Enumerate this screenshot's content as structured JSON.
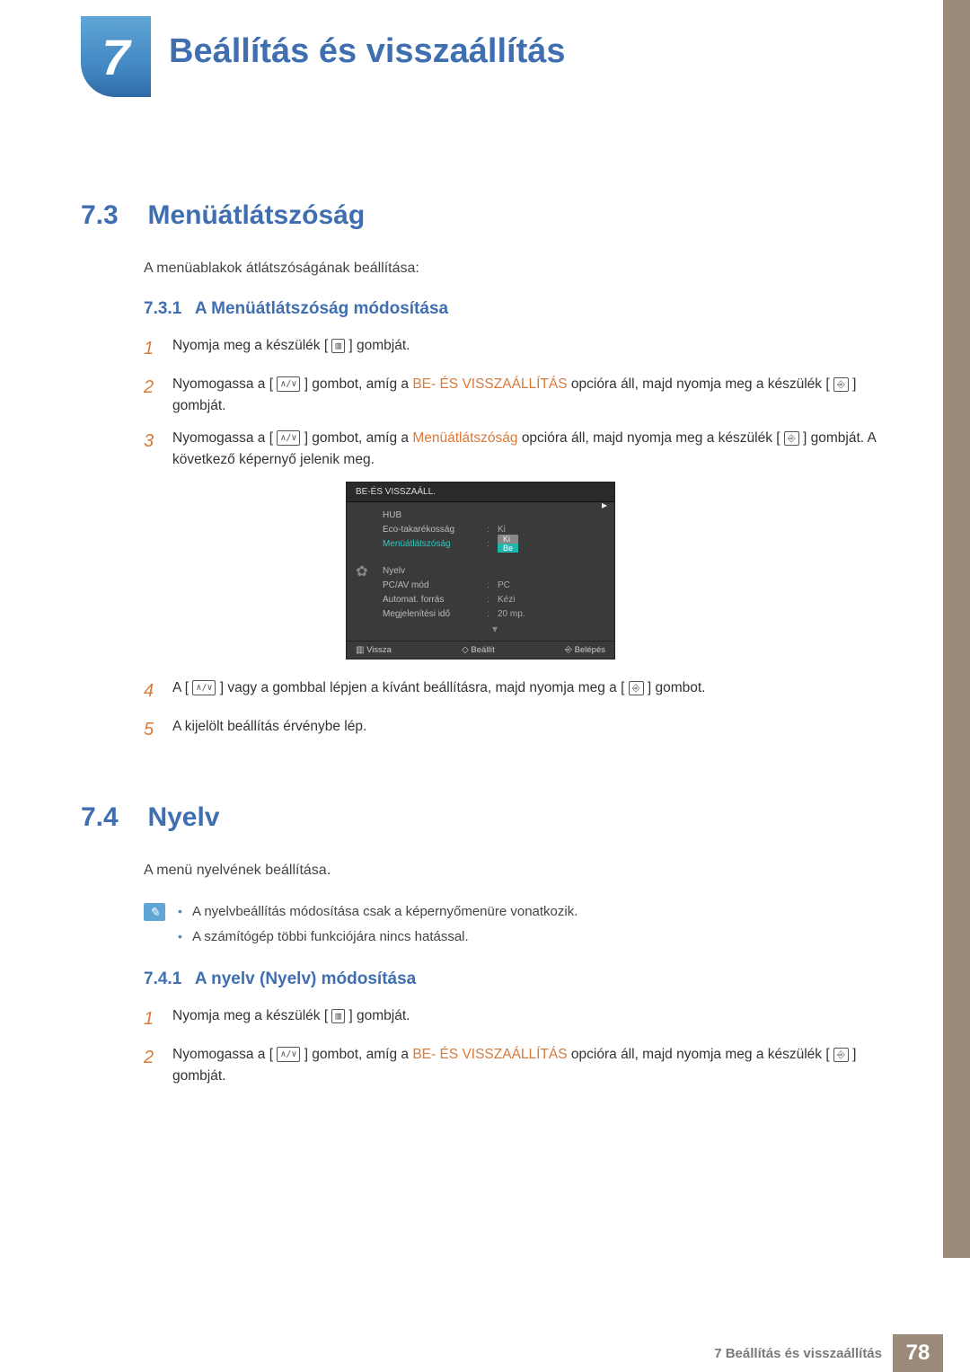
{
  "header": {
    "chapter_num": "7",
    "chapter_title": "Beállítás és visszaállítás"
  },
  "sections": [
    {
      "num": "7.3",
      "title": "Menüátlátszóság",
      "intro": "A menüablakok átlátszóságának beállítása:",
      "subsections": [
        {
          "num": "7.3.1",
          "title": "A Menüátlátszóság módosítása",
          "steps": [
            {
              "n": "1",
              "pre": "Nyomja meg a készülék [",
              "post": " ] gombját."
            },
            {
              "n": "2",
              "a": "Nyomogassa a [",
              "b": "] gombot, amíg a ",
              "hl": "BE- ÉS VISSZAÁLLÍTÁS",
              "c": " opcióra áll, majd nyomja meg a készülék [",
              "d": "] gombját."
            },
            {
              "n": "3",
              "a": "Nyomogassa a [",
              "b": "] gombot, amíg a ",
              "hl": "Menüátlátszóság",
              "c": " opcióra áll, majd nyomja meg a készülék [",
              "d": "] gombját. A következő képernyő jelenik meg."
            },
            {
              "n": "4",
              "a": "A [",
              "b": "] vagy a gombbal lépjen a kívánt beállításra, majd nyomja meg a [",
              "c": "] gombot."
            },
            {
              "n": "5",
              "text": "A kijelölt beállítás érvénybe lép."
            }
          ]
        }
      ]
    },
    {
      "num": "7.4",
      "title": "Nyelv",
      "intro": "A menü nyelvének beállítása.",
      "notes": [
        "A nyelvbeállítás módosítása csak a képernyőmenüre vonatkozik.",
        "A számítógép többi funkciójára nincs hatással."
      ],
      "subsections": [
        {
          "num": "7.4.1",
          "title": "A nyelv (Nyelv) módosítása",
          "steps": [
            {
              "n": "1",
              "pre": "Nyomja meg a készülék [",
              "post": " ] gombját."
            },
            {
              "n": "2",
              "a": "Nyomogassa a [",
              "b": "] gombot, amíg a ",
              "hl": "BE- ÉS VISSZAÁLLÍTÁS",
              "c": " opcióra áll, majd nyomja meg a készülék [",
              "d": "] gombját."
            }
          ]
        }
      ]
    }
  ],
  "osd": {
    "title": "BE-ÉS VISSZAÁLL.",
    "items": [
      {
        "label": "HUB"
      },
      {
        "label": "Eco-takarékosság",
        "value": "Ki"
      },
      {
        "label": "Menüátlátszóság",
        "options": [
          "Ki",
          "Be"
        ]
      },
      {
        "label": "Nyelv"
      },
      {
        "label": "PC/AV mód",
        "value": "PC"
      },
      {
        "label": "Automat. forrás",
        "value": "Kézi"
      },
      {
        "label": "Megjelenítési idő",
        "value": "20 mp."
      }
    ],
    "footer": {
      "back": "Vissza",
      "adjust": "Beállít",
      "enter": "Belépés"
    }
  },
  "footer": {
    "label": "7 Beállítás és visszaállítás",
    "page": "78"
  }
}
